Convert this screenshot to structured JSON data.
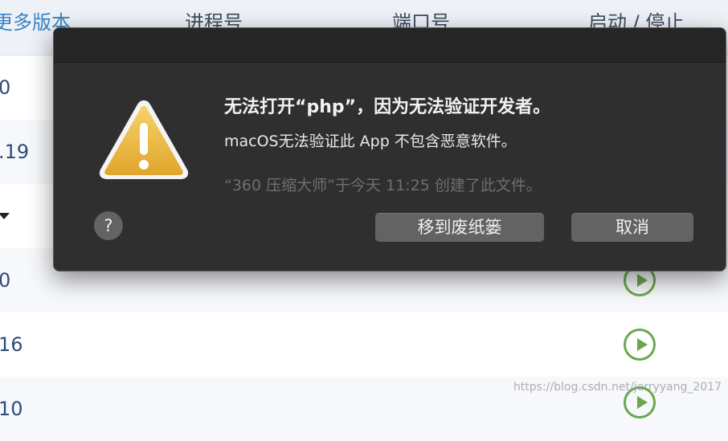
{
  "background_table": {
    "headers": [
      "更多版本",
      "进程号",
      "端口号",
      "启动 / 停止"
    ],
    "rows": [
      {
        "version": "0",
        "control": "none"
      },
      {
        "version": ".19",
        "control": "none"
      },
      {
        "version": "",
        "control": "caret"
      },
      {
        "version": "0",
        "control": "play"
      },
      {
        "version": "16",
        "control": "play"
      },
      {
        "version": "10",
        "control": "play"
      }
    ],
    "accent_green": "#6aa84f",
    "link_blue": "#3a83c9"
  },
  "watermark": "https://blog.csdn.net/jerryyang_2017",
  "dialog": {
    "icon": "warning-icon",
    "title": "无法打开“php”，因为无法验证开发者。",
    "message": "macOS无法验证此 App 不包含恶意软件。",
    "note": "“360 压缩大师”于今天 11:25 创建了此文件。",
    "help_label": "?",
    "move_to_trash_label": "移到废纸篓",
    "cancel_label": "取消"
  }
}
